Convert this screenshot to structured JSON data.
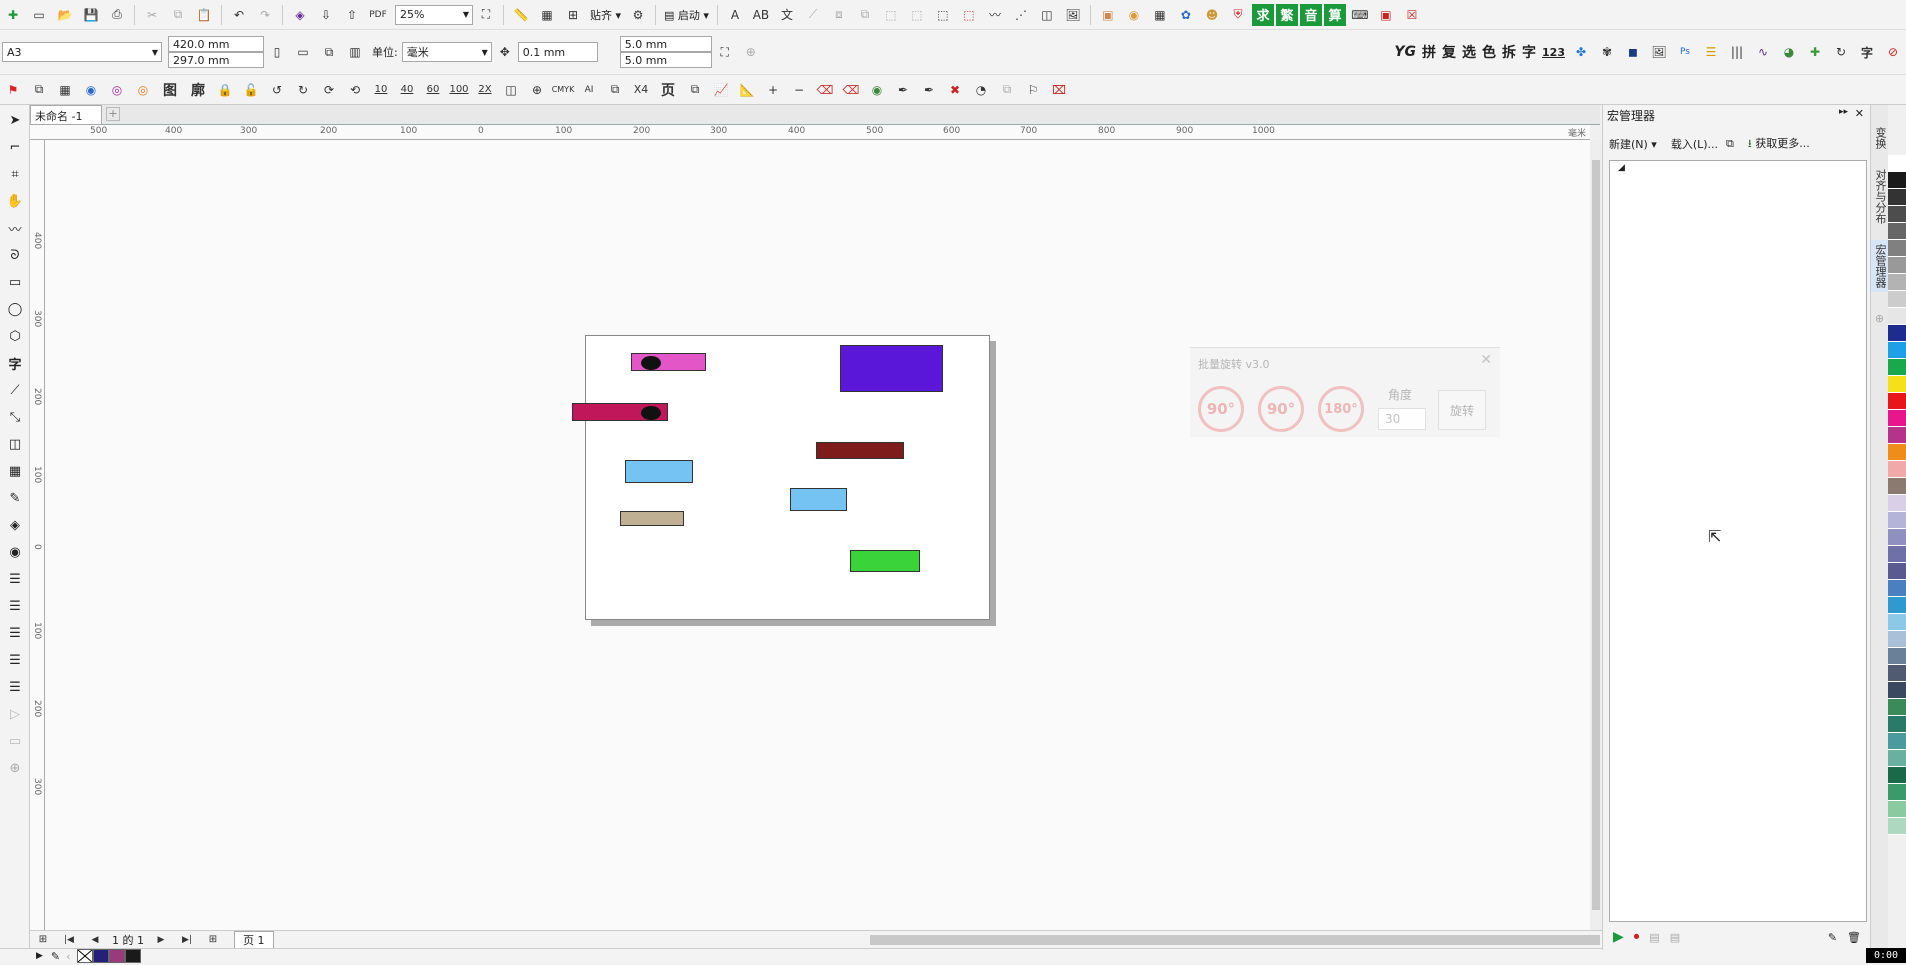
{
  "toolbar_top": {
    "zoom": "25%",
    "snap_label": "贴齐",
    "launch_label": "启动",
    "green_buttons": [
      "求",
      "繁",
      "音",
      "算"
    ]
  },
  "property_bar": {
    "page_size": "A3",
    "width": "420.0 mm",
    "height": "297.0 mm",
    "units_label": "单位:",
    "units_value": "毫米",
    "nudge": "0.1 mm",
    "dup_x": "5.0 mm",
    "dup_y": "5.0 mm",
    "cjk_buttons": [
      "拼",
      "复",
      "选",
      "色",
      "拆",
      "字",
      "123"
    ]
  },
  "toolbar_third": {
    "cjk_labels": [
      "图",
      "廓",
      "页"
    ],
    "number_buttons": [
      "10",
      "40",
      "60",
      "100",
      "2X",
      "X4"
    ]
  },
  "document": {
    "tab_label": "未命名 -1",
    "page_nav": "1 的 1",
    "page_tab": "页 1"
  },
  "ruler": {
    "h_ticks": [
      "500",
      "400",
      "300",
      "200",
      "100",
      "0",
      "100",
      "200",
      "300",
      "400",
      "500",
      "600",
      "700",
      "800",
      "900",
      "1000"
    ],
    "h_unit": "毫米",
    "v_ticks": [
      "400",
      "300",
      "200",
      "100",
      "0",
      "100",
      "200",
      "300"
    ]
  },
  "objects": [
    {
      "color": "#e256c8",
      "dot": true
    },
    {
      "color": "#5b17d9",
      "dot": false
    },
    {
      "color": "#c0175a",
      "dot": true
    },
    {
      "color": "#7e1b1b",
      "dot": false
    },
    {
      "color": "#74c3f2",
      "dot": false
    },
    {
      "color": "#74c3f2",
      "dot": false
    },
    {
      "color": "#bfb093",
      "dot": false
    },
    {
      "color": "#3ad43a",
      "dot": false
    }
  ],
  "dialog": {
    "title": "批量旋转 v3.0",
    "btn_ccw": "90°",
    "btn_cw": "90°",
    "btn_180": "180°",
    "angle_label": "角度",
    "angle_value": "30",
    "rotate_button": "旋转"
  },
  "docker": {
    "title": "宏管理器",
    "new_label": "新建(N)",
    "load_label": "载入(L)...",
    "get_more_label": "获取更多..."
  },
  "vertical_tabs": [
    "变换",
    "对齐与分布",
    "宏管理器"
  ],
  "palette_colors": [
    "#ffffff",
    "#1a1a1a",
    "#333333",
    "#4d4d4d",
    "#666666",
    "#808080",
    "#999999",
    "#b3b3b3",
    "#cccccc",
    "#e6e6e6",
    "#1f2c8f",
    "#1ea0e8",
    "#1aa84c",
    "#f5e01a",
    "#e8161b",
    "#e8168c",
    "#b5338a",
    "#f08c1a",
    "#f0a8a8",
    "#8a7a70",
    "#d9d0e8",
    "#b4b4d8",
    "#9090c0",
    "#7070a8",
    "#5a5a90",
    "#4a7fc0",
    "#2e9ad0",
    "#8cc8e8",
    "#a8c0d8",
    "#6a8098",
    "#505a70",
    "#3a4860",
    "#3a8a5a",
    "#2a7a6a",
    "#4a9aa0",
    "#6ab0a0",
    "#1a6a4a",
    "#3a9a6a",
    "#8acaa0",
    "#aed8c0"
  ],
  "status": {
    "swatches": [
      "#ffffff",
      "#22227a",
      "#9a3a7a",
      "#1a1a1a"
    ],
    "timer": "0:00"
  }
}
